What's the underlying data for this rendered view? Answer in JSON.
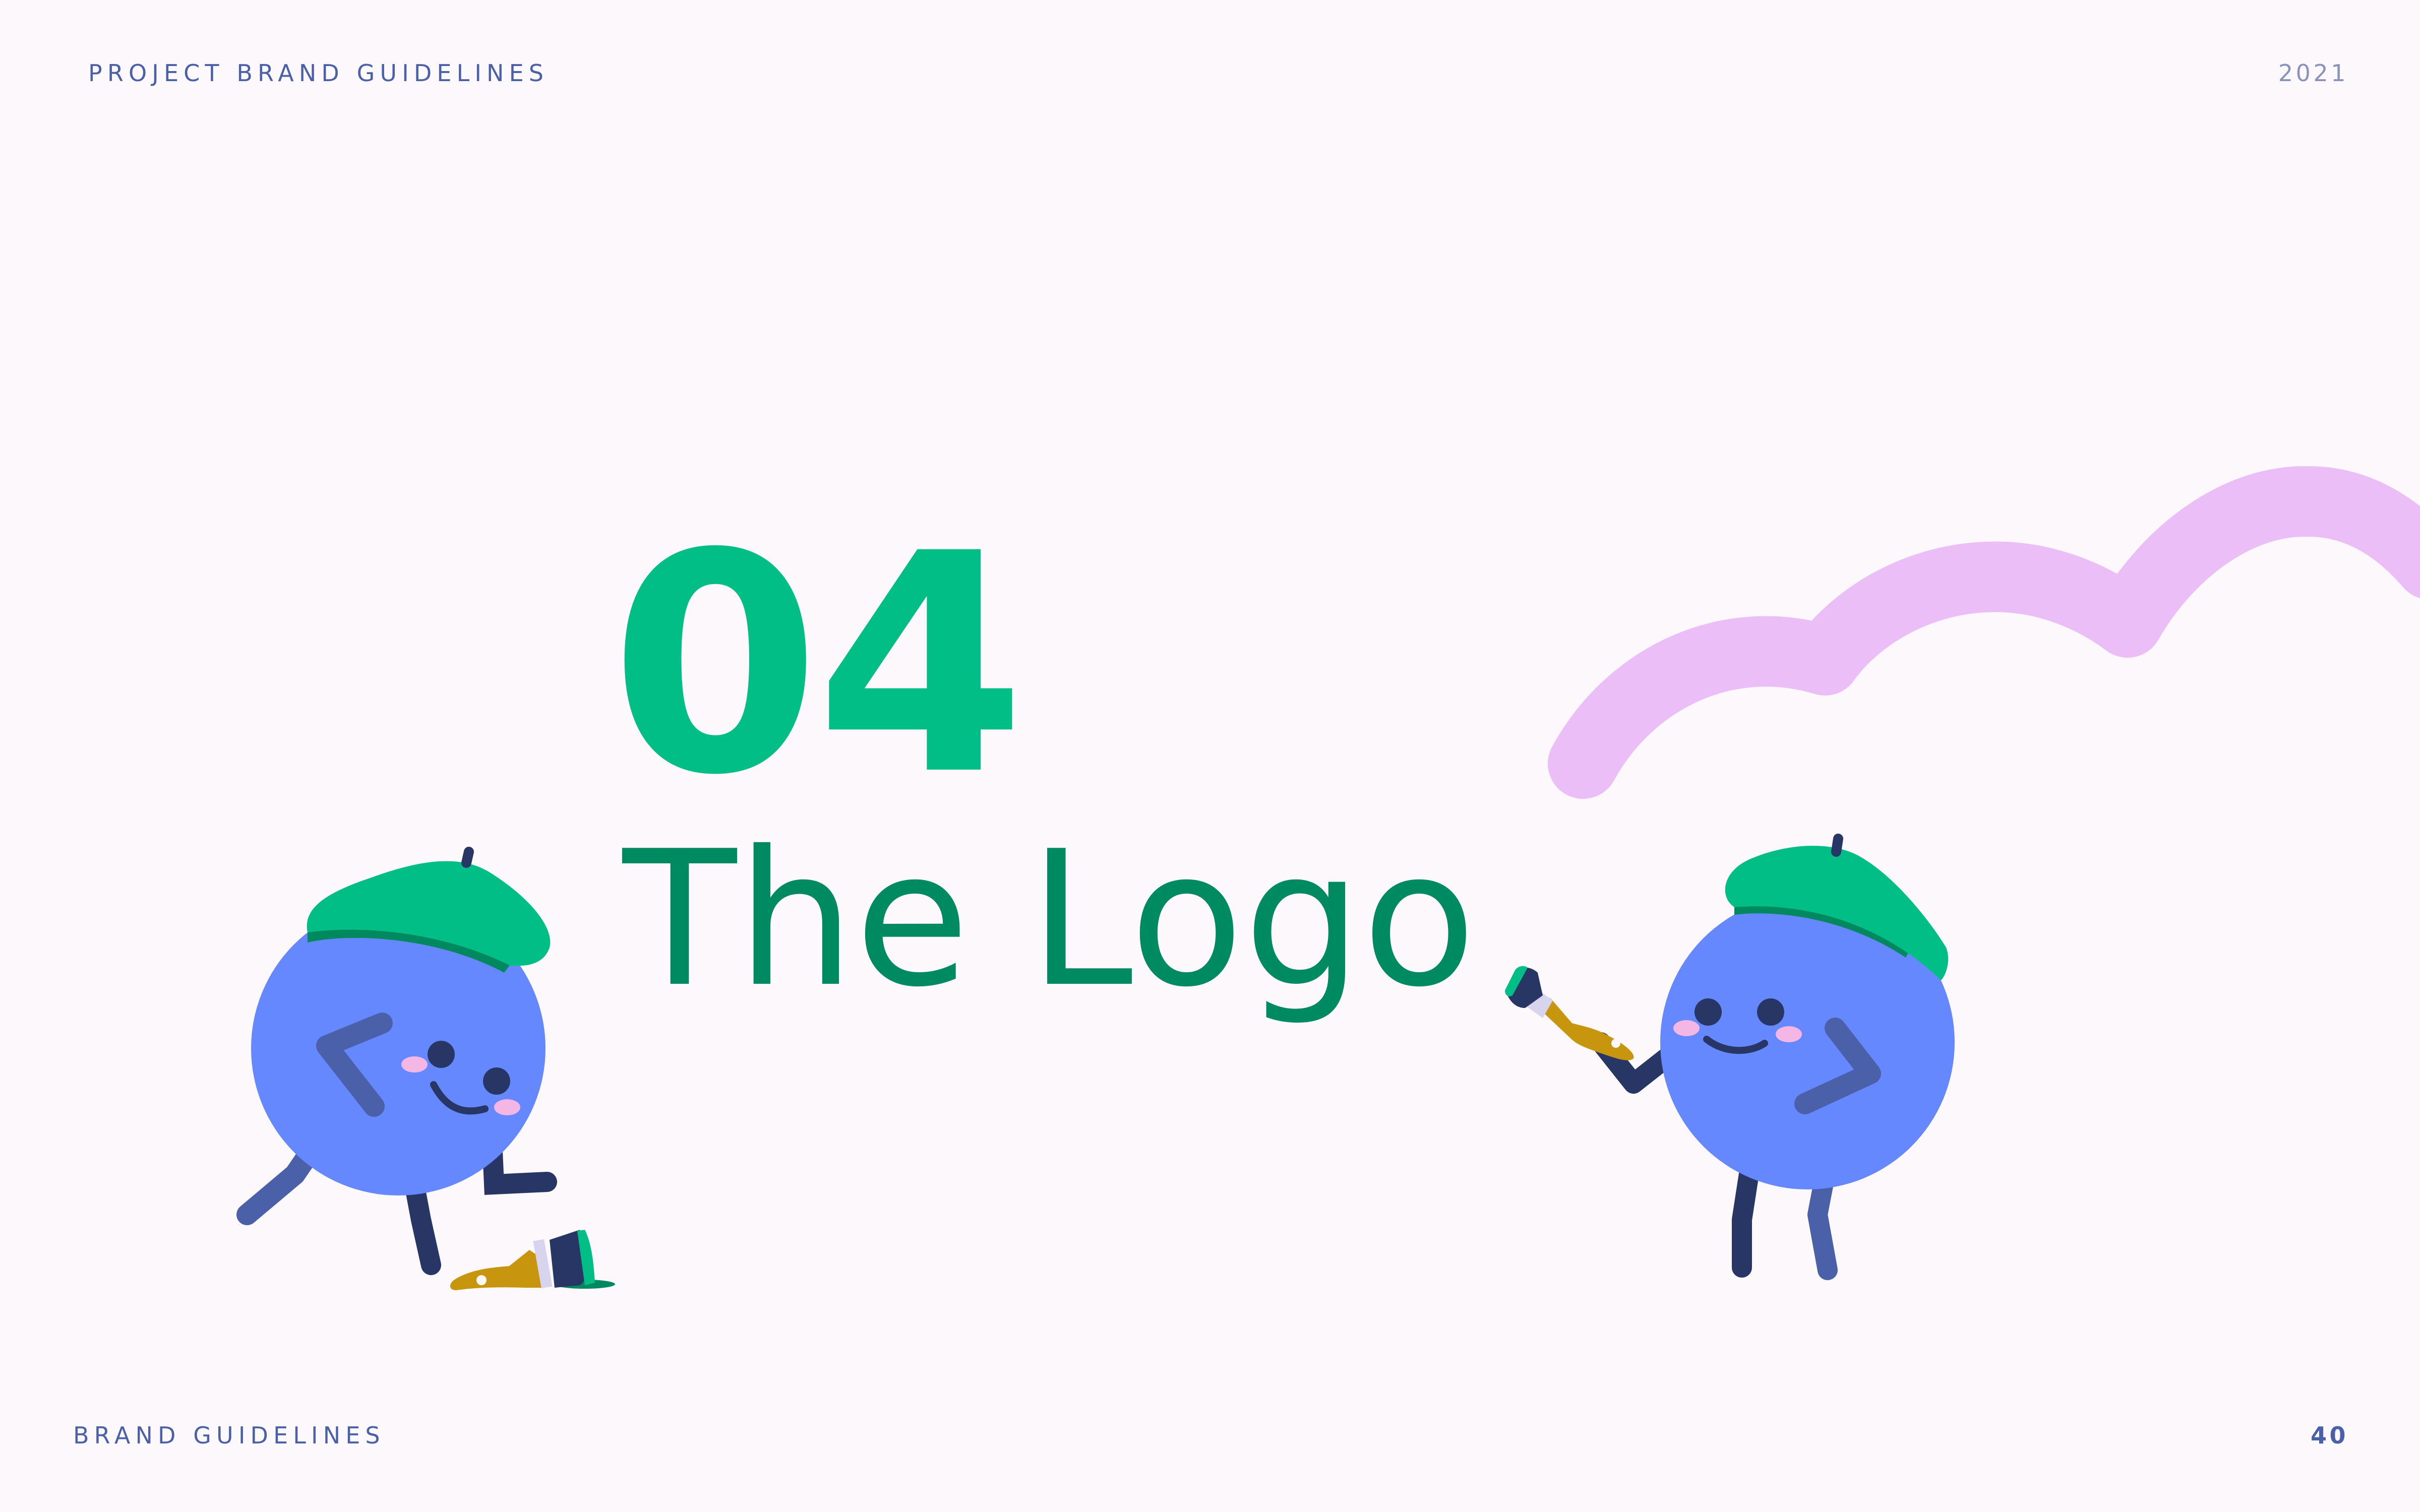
{
  "header": {
    "left": "PROJECT BRAND GUIDELINES",
    "right": "2021"
  },
  "section": {
    "number": "04",
    "title": "The Logo"
  },
  "footer": {
    "left": "BRAND GUIDELINES",
    "page": "40"
  },
  "colors": {
    "background": "#fdf8fb",
    "accent_green": "#00be85",
    "title_green": "#008a62",
    "character_blue": "#6688ff",
    "header_blue": "#4a60a8",
    "cloud_pink": "#ebbef8",
    "beret_green": "#00be85",
    "brush_gold": "#c8950f",
    "navy": "#283665"
  },
  "illustrations": [
    "cloud-squiggle",
    "painter-character-left",
    "painter-character-right",
    "paint-brush-dropped",
    "paint-brush-held"
  ]
}
